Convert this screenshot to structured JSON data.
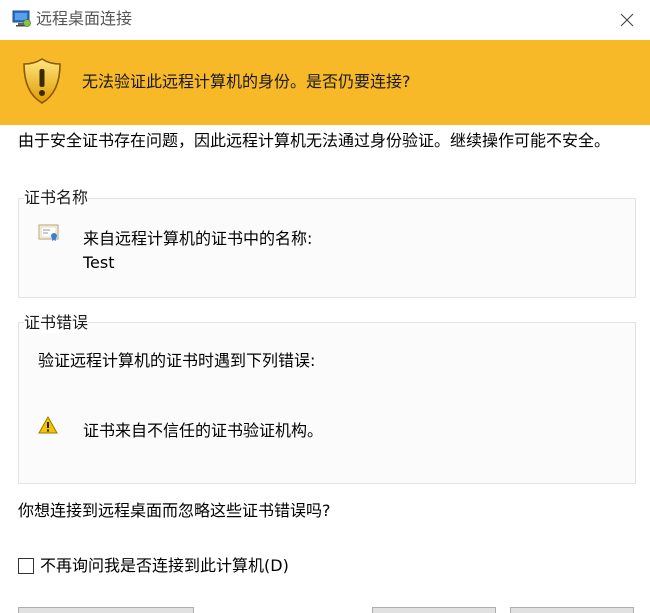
{
  "window": {
    "title": "远程桌面连接",
    "app_icon": "remote-desktop-icon",
    "close_icon": "close-icon"
  },
  "banner": {
    "icon": "shield-warning-icon",
    "message": "无法验证此远程计算机的身份。是否仍要连接?",
    "color": "#f8b928"
  },
  "intro": "由于安全证书存在问题，因此远程计算机无法通过身份验证。继续操作可能不安全。",
  "cert_name_group": {
    "label": "证书名称",
    "icon": "certificate-icon",
    "line1": "来自远程计算机的证书中的名称:",
    "line2": "Test"
  },
  "cert_error_group": {
    "label": "证书错误",
    "intro": "验证远程计算机的证书时遇到下列错误:",
    "error_icon": "warning-icon",
    "error_text": "证书来自不信任的证书验证机构。"
  },
  "question": "你想连接到远程桌面而忽略这些证书错误吗?",
  "checkbox": {
    "label": "不再询问我是否连接到此计算机(D)",
    "checked": false
  },
  "buttons": {
    "view_certificate": "",
    "yes": "",
    "no": ""
  }
}
